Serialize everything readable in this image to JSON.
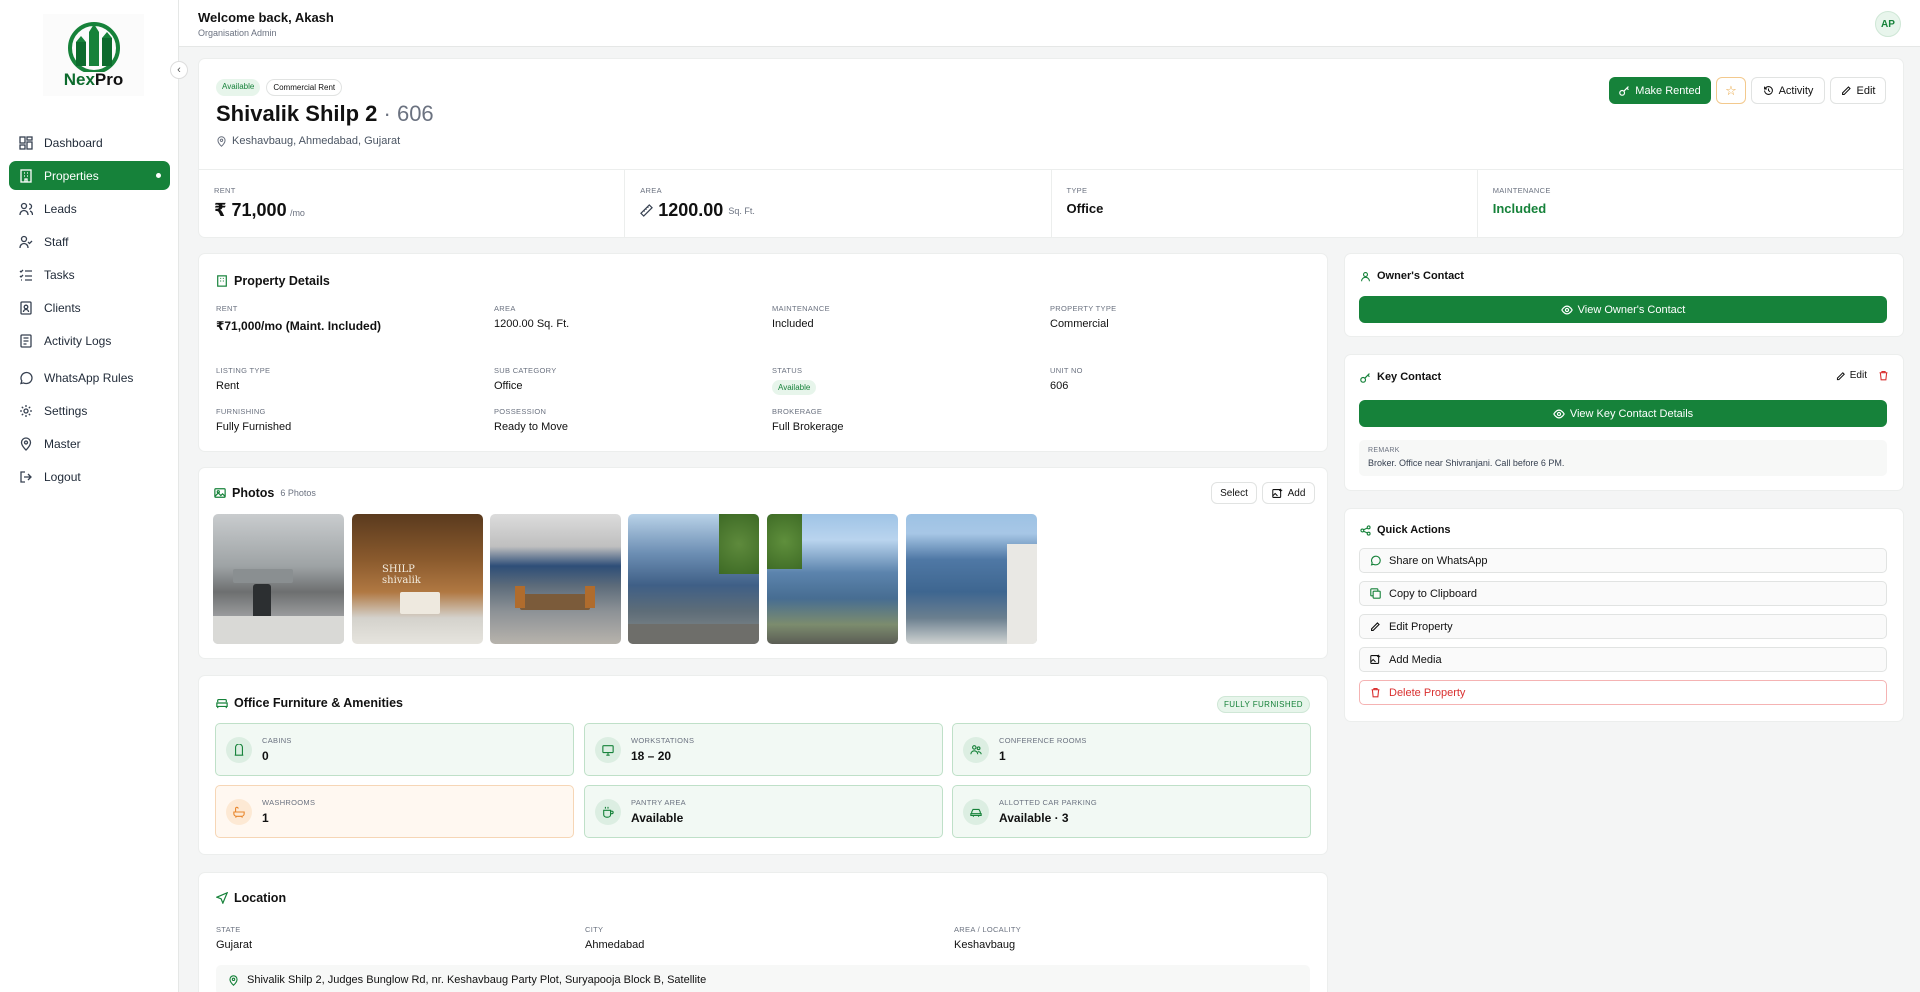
{
  "brand": {
    "name_part1": "Nex",
    "name_part2": "Pro"
  },
  "sidebar": {
    "items": [
      {
        "label": "Dashboard",
        "icon": "dashboard-icon"
      },
      {
        "label": "Properties",
        "icon": "building-icon",
        "active": true
      },
      {
        "label": "Leads",
        "icon": "users-icon"
      },
      {
        "label": "Staff",
        "icon": "user-check-icon"
      },
      {
        "label": "Tasks",
        "icon": "tasks-icon"
      },
      {
        "label": "Clients",
        "icon": "contact-book-icon"
      },
      {
        "label": "Activity Logs",
        "icon": "logs-icon"
      },
      {
        "label": "WhatsApp Rules",
        "icon": "whatsapp-icon"
      },
      {
        "label": "Settings",
        "icon": "gear-icon"
      },
      {
        "label": "Master",
        "icon": "map-pin-icon"
      },
      {
        "label": "Logout",
        "icon": "logout-icon"
      }
    ]
  },
  "header": {
    "welcome": "Welcome back, Akash",
    "role": "Organisation Admin",
    "avatar": "AP"
  },
  "property": {
    "badge_status": "Available",
    "badge_listing": "Commercial Rent",
    "name": "Shivalik Shilp 2",
    "unit_suffix": "· 606",
    "address": "Keshavbaug, Ahmedabad, Gujarat",
    "actions": {
      "make_rented": "Make Rented",
      "activity": "Activity",
      "edit": "Edit"
    }
  },
  "stats": [
    {
      "label": "RENT",
      "value": "₹ 71,000",
      "unit": "/mo"
    },
    {
      "label": "AREA",
      "value": "1200.00",
      "unit": "Sq. Ft."
    },
    {
      "label": "TYPE",
      "value": "Office",
      "unit": ""
    },
    {
      "label": "MAINTENANCE",
      "value": "Included",
      "unit": ""
    }
  ],
  "details": {
    "title": "Property Details",
    "fields": [
      {
        "label": "RENT",
        "value": "₹71,000/mo (Maint. Included)"
      },
      {
        "label": "AREA",
        "value": "1200.00 Sq. Ft."
      },
      {
        "label": "MAINTENANCE",
        "value": "Included"
      },
      {
        "label": "PROPERTY TYPE",
        "value": "Commercial"
      },
      {
        "label": "LISTING TYPE",
        "value": "Rent"
      },
      {
        "label": "SUB CATEGORY",
        "value": "Office"
      },
      {
        "label": "STATUS",
        "value": "Available"
      },
      {
        "label": "UNIT NO",
        "value": "606"
      },
      {
        "label": "FURNISHING",
        "value": "Fully Furnished"
      },
      {
        "label": "POSSESSION",
        "value": "Ready to Move"
      },
      {
        "label": "BROKERAGE",
        "value": "Full Brokerage"
      }
    ]
  },
  "photos": {
    "title": "Photos",
    "count": "6 Photos",
    "select": "Select",
    "add": "Add"
  },
  "amenities": {
    "title": "Office Furniture & Amenities",
    "badge": "FULLY FURNISHED",
    "items": [
      {
        "label": "CABINS",
        "value": "0",
        "icon": "cabin-icon"
      },
      {
        "label": "WORKSTATIONS",
        "value": "18 – 20",
        "icon": "monitor-icon"
      },
      {
        "label": "CONFERENCE ROOMS",
        "value": "1",
        "icon": "group-icon"
      },
      {
        "label": "WASHROOMS",
        "value": "1",
        "icon": "bath-icon"
      },
      {
        "label": "PANTRY AREA",
        "value": "Available",
        "icon": "coffee-icon"
      },
      {
        "label": "ALLOTTED CAR PARKING",
        "value": "Available · 3",
        "icon": "car-icon"
      }
    ]
  },
  "location": {
    "title": "Location",
    "fields": [
      {
        "label": "STATE",
        "value": "Gujarat"
      },
      {
        "label": "CITY",
        "value": "Ahmedabad"
      },
      {
        "label": "AREA / LOCALITY",
        "value": "Keshavbaug"
      }
    ],
    "address": "Shivalik Shilp 2, Judges Bunglow Rd, nr. Keshavbaug Party Plot, Suryapooja Block B, Satellite"
  },
  "owner": {
    "title": "Owner's Contact",
    "button": "View Owner's Contact"
  },
  "key_contact": {
    "title": "Key Contact",
    "edit": "Edit",
    "button": "View Key Contact Details",
    "remark_label": "REMARK",
    "remark": "Broker. Office near Shivranjani. Call before 6 PM."
  },
  "quick_actions": {
    "title": "Quick Actions",
    "items": [
      {
        "label": "Share on WhatsApp",
        "icon": "whatsapp-icon"
      },
      {
        "label": "Copy to Clipboard",
        "icon": "copy-icon"
      },
      {
        "label": "Edit Property",
        "icon": "pencil-icon"
      },
      {
        "label": "Add Media",
        "icon": "image-add-icon"
      },
      {
        "label": "Delete Property",
        "icon": "trash-icon",
        "danger": true
      }
    ]
  },
  "colors": {
    "accent": "#16823a",
    "danger": "#d93030"
  }
}
